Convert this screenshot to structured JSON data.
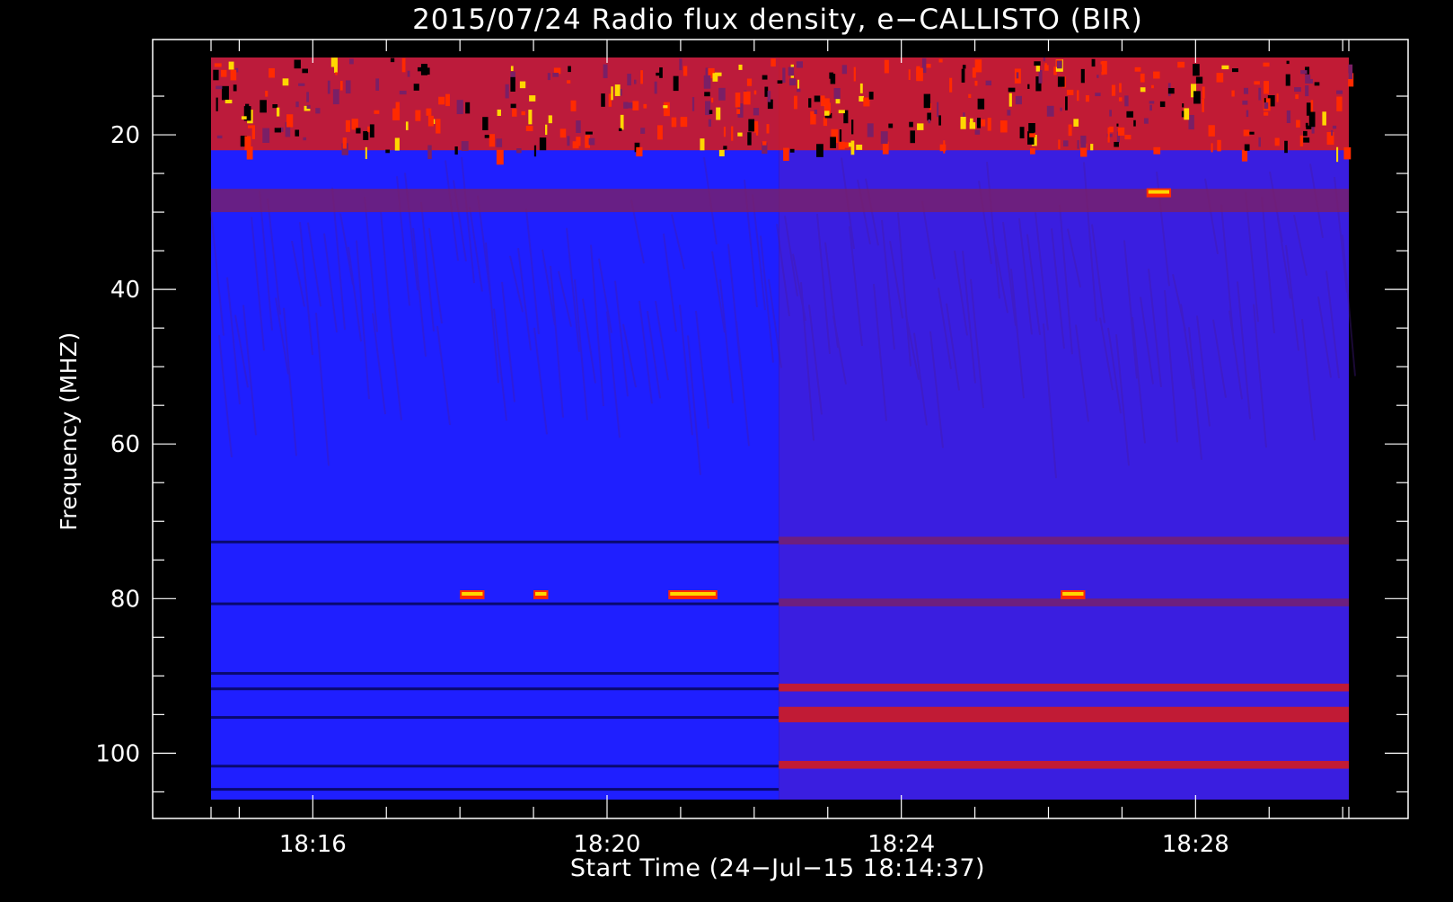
{
  "chart_data": {
    "type": "heatmap",
    "title": "2015/07/24  Radio flux density, e−CALLISTO (BIR)",
    "xlabel": "Start Time (24−Jul−15 18:14:37)",
    "ylabel": "Frequency (MHZ)",
    "x_unit": "time",
    "x_range": [
      "18:14:37",
      "18:30:05"
    ],
    "x_ticks": [
      "18:16",
      "18:20",
      "18:24",
      "18:28"
    ],
    "y_range": [
      10,
      106
    ],
    "y_inverted": true,
    "y_ticks": [
      20,
      40,
      60,
      80,
      100
    ],
    "grid": false,
    "colormap": [
      "#000000",
      "#1a1aff",
      "#7a1f66",
      "#ff1a00",
      "#ffd700",
      "#ffffff"
    ],
    "regimes": [
      {
        "start": "18:14:37",
        "end": "18:22:20",
        "background": "#1f1fff"
      },
      {
        "start": "18:22:20",
        "end": "18:30:05",
        "background": "#3a1ee0"
      }
    ],
    "bands": [
      {
        "f_min": 10,
        "f_max": 22,
        "start": "18:14:37",
        "end": "18:30:05",
        "level": "strong bursts"
      },
      {
        "f_min": 27,
        "f_max": 30,
        "start": "18:14:37",
        "end": "18:30:05",
        "level": "moderate"
      },
      {
        "f_min": 72,
        "f_max": 73,
        "start": "18:22:20",
        "end": "18:30:05",
        "level": "moderate"
      },
      {
        "f_min": 80,
        "f_max": 81,
        "start": "18:22:20",
        "end": "18:30:05",
        "level": "moderate"
      },
      {
        "f_min": 91,
        "f_max": 92,
        "start": "18:22:20",
        "end": "18:30:05",
        "level": "strong"
      },
      {
        "f_min": 94,
        "f_max": 96,
        "start": "18:22:20",
        "end": "18:30:05",
        "level": "strong"
      },
      {
        "f_min": 101,
        "f_max": 102,
        "start": "18:22:20",
        "end": "18:30:05",
        "level": "strong"
      }
    ],
    "spots": [
      {
        "f": 79.5,
        "start": "18:18:00",
        "end": "18:18:20"
      },
      {
        "f": 79.5,
        "start": "18:19:00",
        "end": "18:19:12"
      },
      {
        "f": 79.5,
        "start": "18:20:50",
        "end": "18:21:30"
      },
      {
        "f": 79.5,
        "start": "18:26:10",
        "end": "18:26:30"
      },
      {
        "f": 27.5,
        "start": "18:27:20",
        "end": "18:27:40"
      }
    ]
  }
}
